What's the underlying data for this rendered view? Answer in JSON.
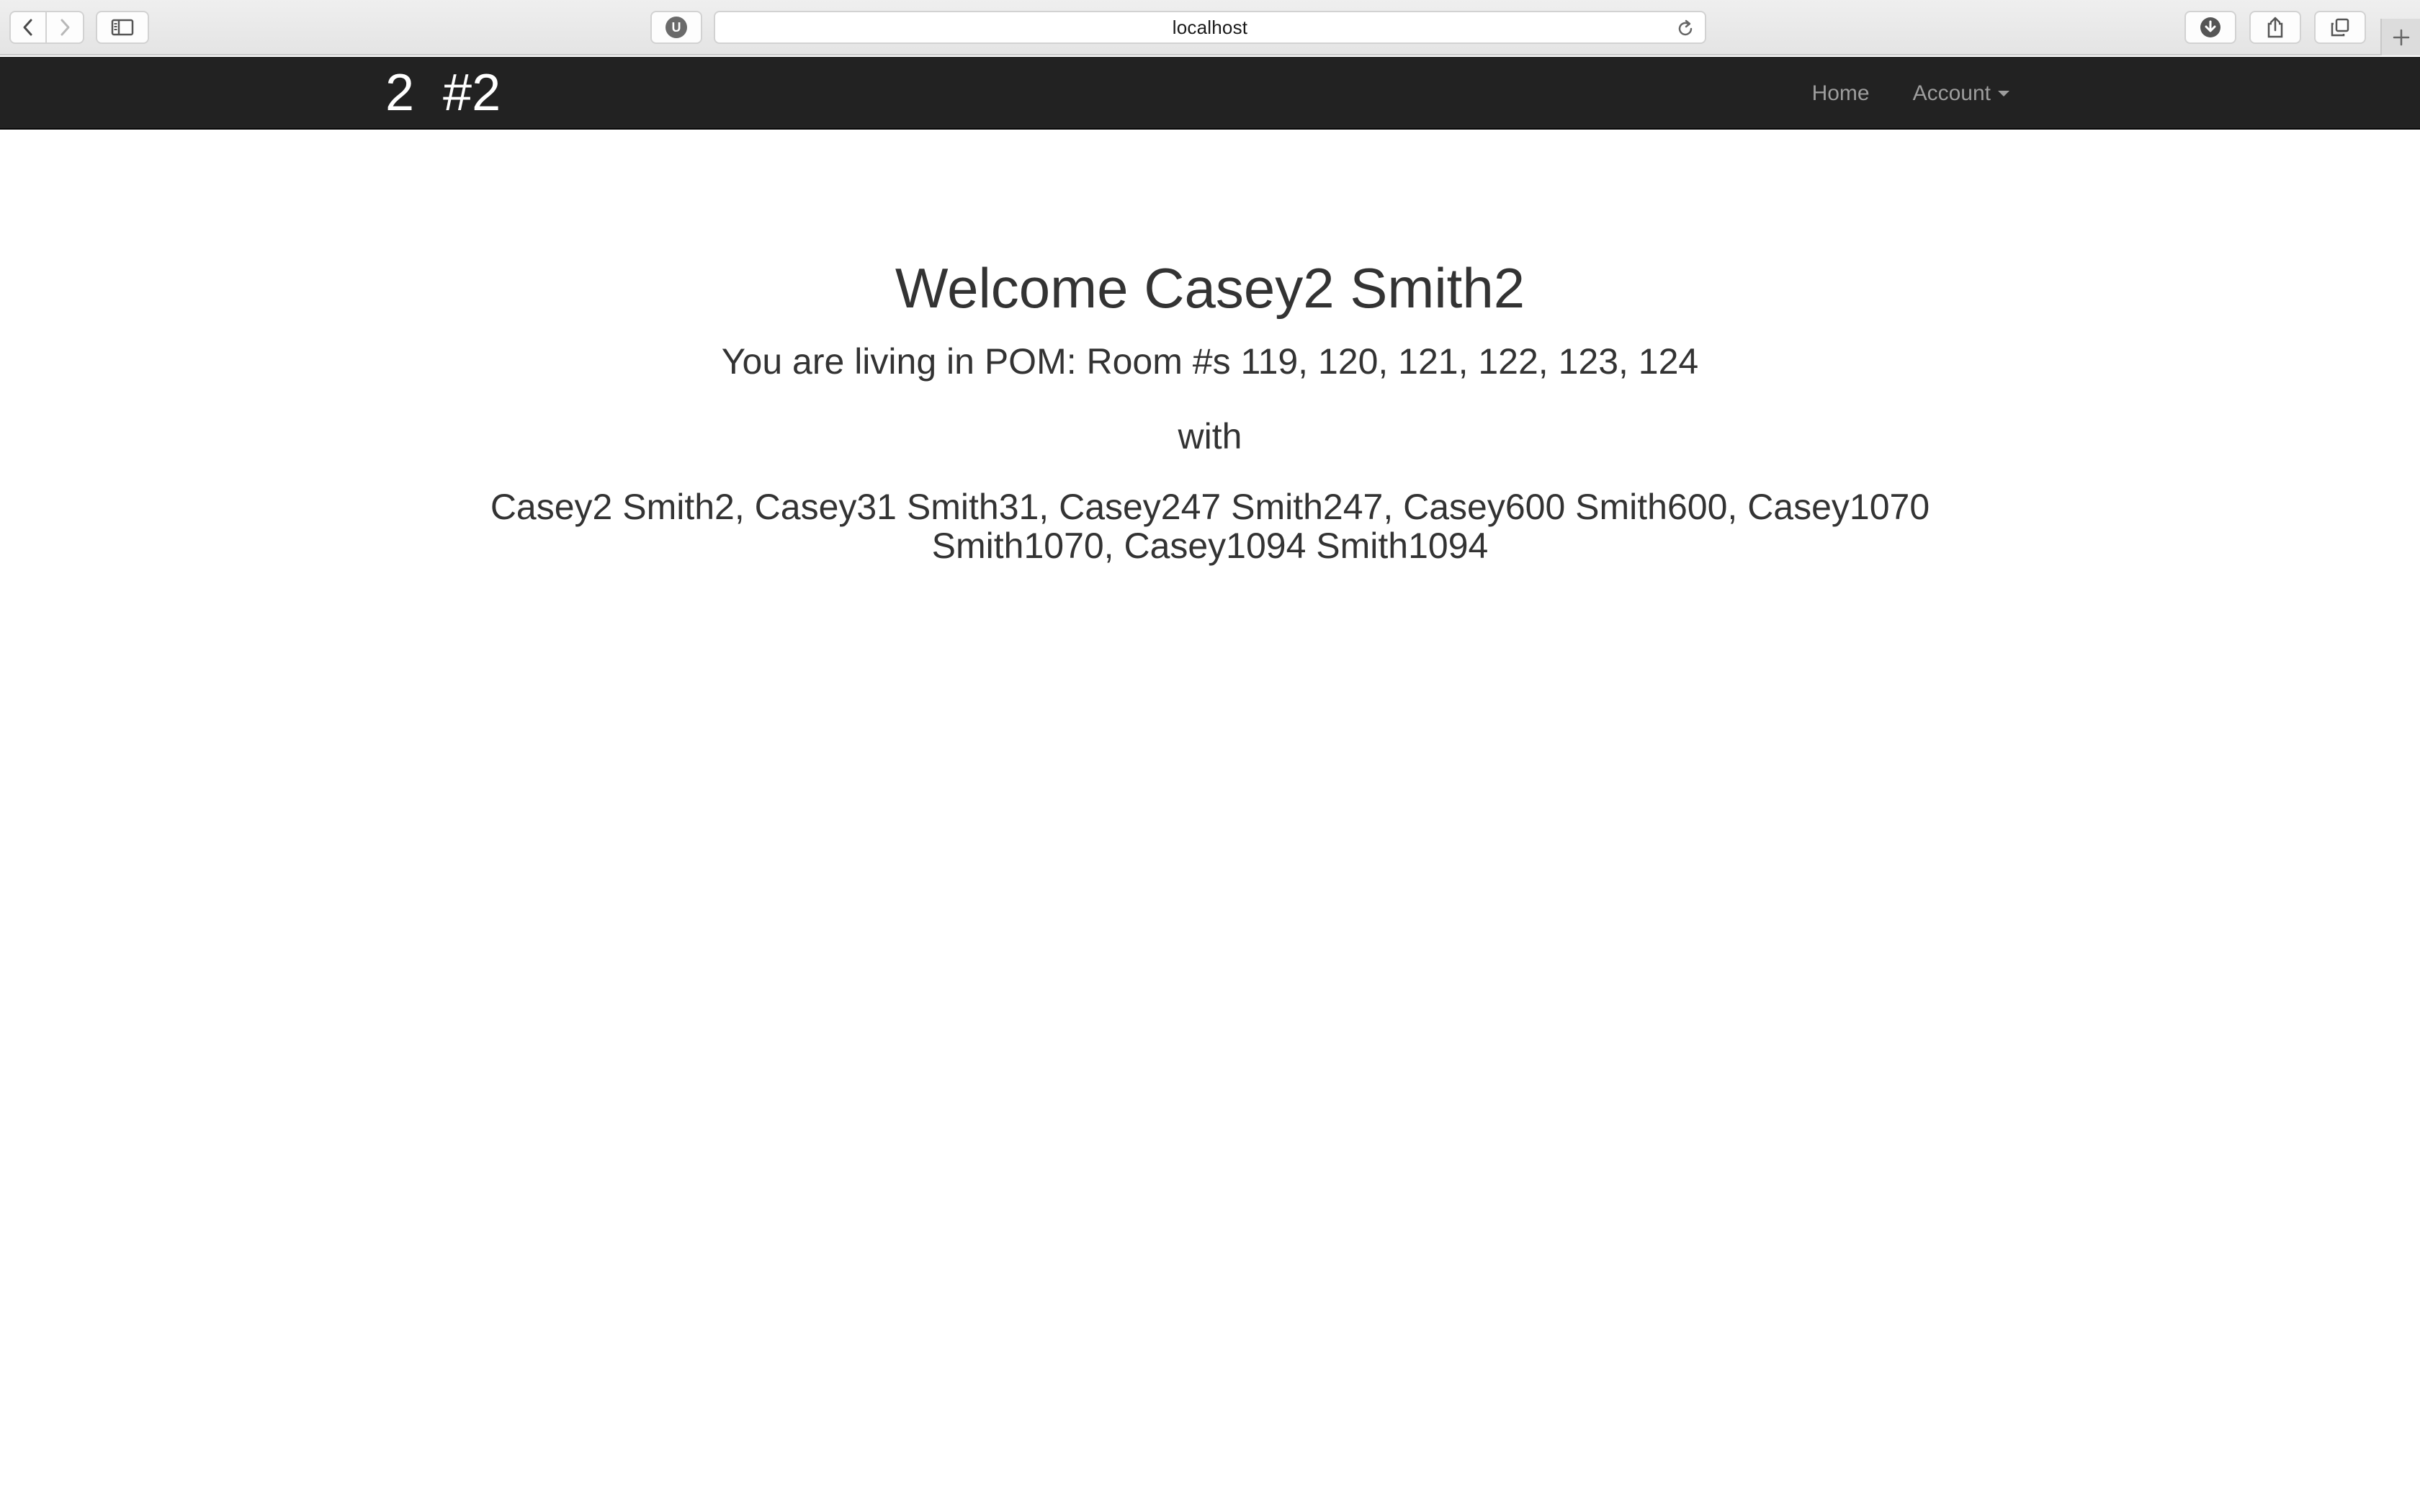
{
  "browser": {
    "url": "localhost",
    "extension_letter": "U"
  },
  "navbar": {
    "brand": "2  #2",
    "links": {
      "home": "Home",
      "account": "Account"
    }
  },
  "main": {
    "welcome": "Welcome Casey2 Smith2",
    "living": "You are living in POM: Room #s 119, 120, 121, 122, 123, 124",
    "with": "with",
    "roommates": "Casey2 Smith2, Casey31 Smith31, Casey247 Smith247, Casey600 Smith600, Casey1070 Smith1070, Casey1094 Smith1094"
  },
  "colors": {
    "navbar_bg": "#222222",
    "nav_link": "#9d9d9d",
    "text": "#333333"
  }
}
